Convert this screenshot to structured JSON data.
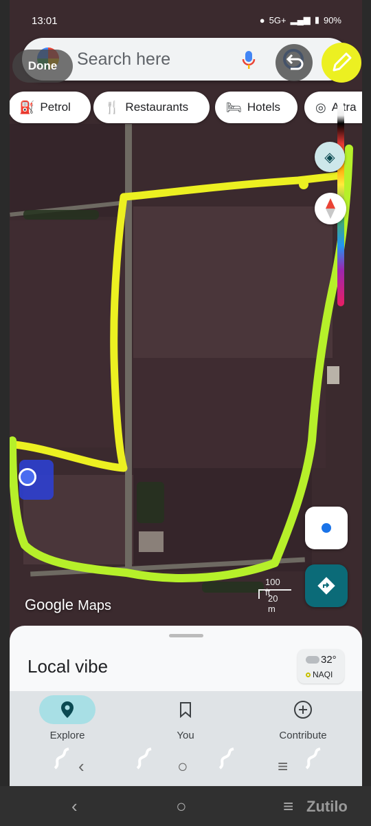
{
  "status_bar": {
    "time": "13:01",
    "network": "5G+",
    "battery": "90%"
  },
  "search": {
    "placeholder": "Search here"
  },
  "markup": {
    "done_label": "Done"
  },
  "chips": [
    {
      "label": "Petrol",
      "icon": "fuel-icon"
    },
    {
      "label": "Restaurants",
      "icon": "restaurant-icon"
    },
    {
      "label": "Hotels",
      "icon": "hotel-icon"
    },
    {
      "label": "Attra",
      "icon": "attraction-icon"
    }
  ],
  "map": {
    "logo_google": "Google",
    "logo_maps": "Maps",
    "scale_ft": "100 ft",
    "scale_m": "20 m"
  },
  "sheet": {
    "title": "Local vibe",
    "weather": {
      "temp": "32°",
      "aqi": "NAQI"
    }
  },
  "bottom_nav": [
    {
      "label": "Explore",
      "icon": "pin-icon",
      "active": true
    },
    {
      "label": "You",
      "icon": "bookmark-icon",
      "active": false
    },
    {
      "label": "Contribute",
      "icon": "plus-circle-icon",
      "active": false
    }
  ],
  "watermark": "Zutilo",
  "colors": {
    "highlight_yellow": "#ecf021",
    "highlight_green": "#b6f02a",
    "accent_teal": "#0b6b78",
    "explore_pill": "#a8dfe5"
  }
}
